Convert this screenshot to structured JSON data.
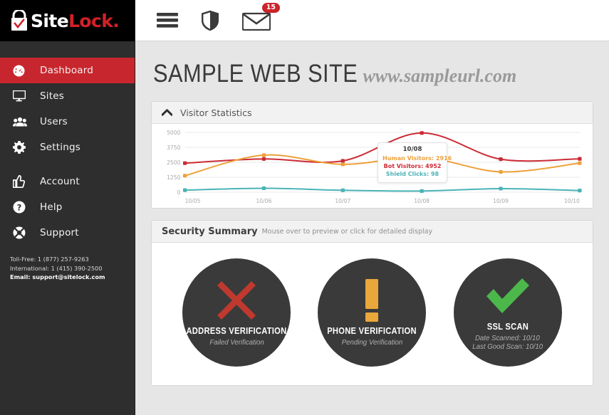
{
  "brand": {
    "name_part1": "Site",
    "name_part2": "Lock",
    "name_dot": ".",
    "lock_icon": "lock-check-icon",
    "accent_red": "#d32028",
    "sidebar_bg": "#2e2e2e"
  },
  "sidebar": {
    "items": [
      {
        "label": "Dashboard",
        "icon": "dashboard-gauge-icon",
        "active": true
      },
      {
        "label": "Sites",
        "icon": "monitor-icon",
        "active": false
      },
      {
        "label": "Users",
        "icon": "users-icon",
        "active": false
      },
      {
        "label": "Settings",
        "icon": "gear-icon",
        "active": false
      },
      {
        "label": "Account",
        "icon": "thumbs-up-icon",
        "active": false
      },
      {
        "label": "Help",
        "icon": "question-circle-icon",
        "active": false
      },
      {
        "label": "Support",
        "icon": "lifebuoy-icon",
        "active": false
      }
    ],
    "contact": {
      "tollfree": "Toll-Free: 1 (877) 257-9263",
      "international": "International: 1 (415) 390-2500",
      "email": "Email: support@sitelock.com"
    }
  },
  "topbar": {
    "menu_icon": "hamburger-menu-icon",
    "shield_icon": "shield-icon",
    "mail_icon": "envelope-icon",
    "mail_badge": "15"
  },
  "header": {
    "site_name": "SAMPLE WEB SITE",
    "site_url": "www.sampleurl.com"
  },
  "visitor_panel": {
    "title": "Visitor Statistics",
    "collapse_icon": "chevron-up-icon"
  },
  "security_panel": {
    "title": "Security Summary",
    "hint": "Mouse over to preview or click for detailed display",
    "cards": [
      {
        "title": "ADDRESS VERIFICATION",
        "sub": "Failed Verification",
        "icon": "x-mark-icon",
        "color": "#c0392e"
      },
      {
        "title": "PHONE VERIFICATION",
        "sub": "Pending Verification",
        "icon": "exclamation-mark-icon",
        "color": "#eaa83a"
      },
      {
        "title": "SSL SCAN",
        "sub": "Date Scanned: 10/10",
        "sub2": "Last Good Scan: 10/10",
        "icon": "check-mark-icon",
        "color": "#4cb84c"
      }
    ]
  },
  "tooltip": {
    "date": "10/08",
    "human_label": "Human Visitors:",
    "human_value": "2916",
    "bot_label": "Bot Visitors:",
    "bot_value": "4952",
    "shield_label": "Shield Clicks:",
    "shield_value": "98"
  },
  "chart_data": {
    "type": "line",
    "title": "Visitor Statistics",
    "xlabel": "",
    "ylabel": "",
    "x": [
      "10/05",
      "10/06",
      "10/07",
      "10/08",
      "10/09",
      "10/10"
    ],
    "ylim": [
      0,
      5000
    ],
    "yticks": [
      0,
      1250,
      2500,
      3750,
      5000
    ],
    "ytick_labels": [
      "0",
      "1250",
      "2500",
      "3750",
      "5000"
    ],
    "grid": true,
    "legend": "none",
    "series": [
      {
        "name": "Bot Visitors",
        "color": "#cc2b36",
        "values": [
          2430,
          2780,
          2620,
          4952,
          2760,
          2790
        ]
      },
      {
        "name": "Human Visitors",
        "color": "#eda13b",
        "values": [
          1380,
          3100,
          2330,
          2916,
          1700,
          2430
        ]
      },
      {
        "name": "Shield Clicks",
        "color": "#4ab3b7",
        "values": [
          170,
          330,
          160,
          98,
          300,
          140
        ]
      }
    ]
  }
}
